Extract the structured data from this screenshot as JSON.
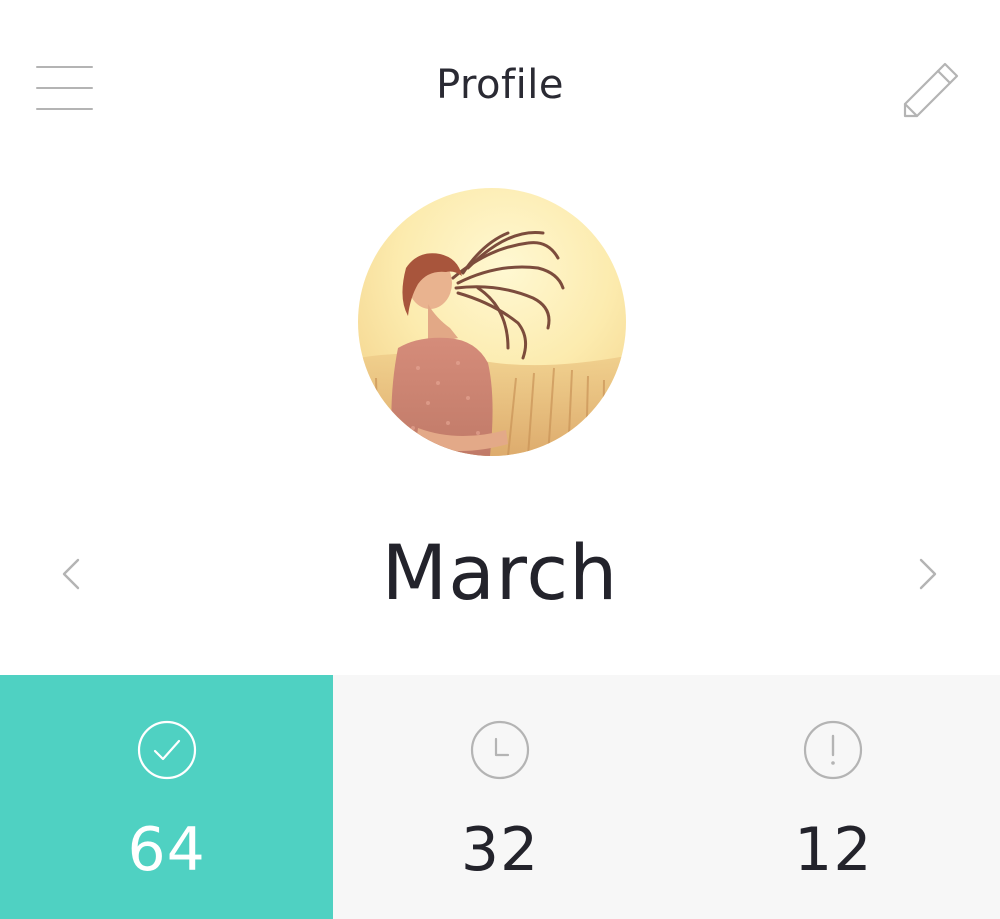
{
  "header": {
    "title": "Profile",
    "menu_icon": "hamburger-menu-icon",
    "edit_icon": "pencil-icon"
  },
  "profile": {
    "avatar": "profile-photo"
  },
  "month_selector": {
    "month": "March",
    "prev_icon": "chevron-left-icon",
    "next_icon": "chevron-right-icon"
  },
  "stats": [
    {
      "icon": "check-circle-icon",
      "value": "64",
      "active": true
    },
    {
      "icon": "clock-icon",
      "value": "32",
      "active": false
    },
    {
      "icon": "alert-circle-icon",
      "value": "12",
      "active": false
    }
  ],
  "colors": {
    "accent": "#4fd1c2",
    "text": "#23232b",
    "muted": "#b4b4b4",
    "stats_bg": "#f7f7f7"
  }
}
